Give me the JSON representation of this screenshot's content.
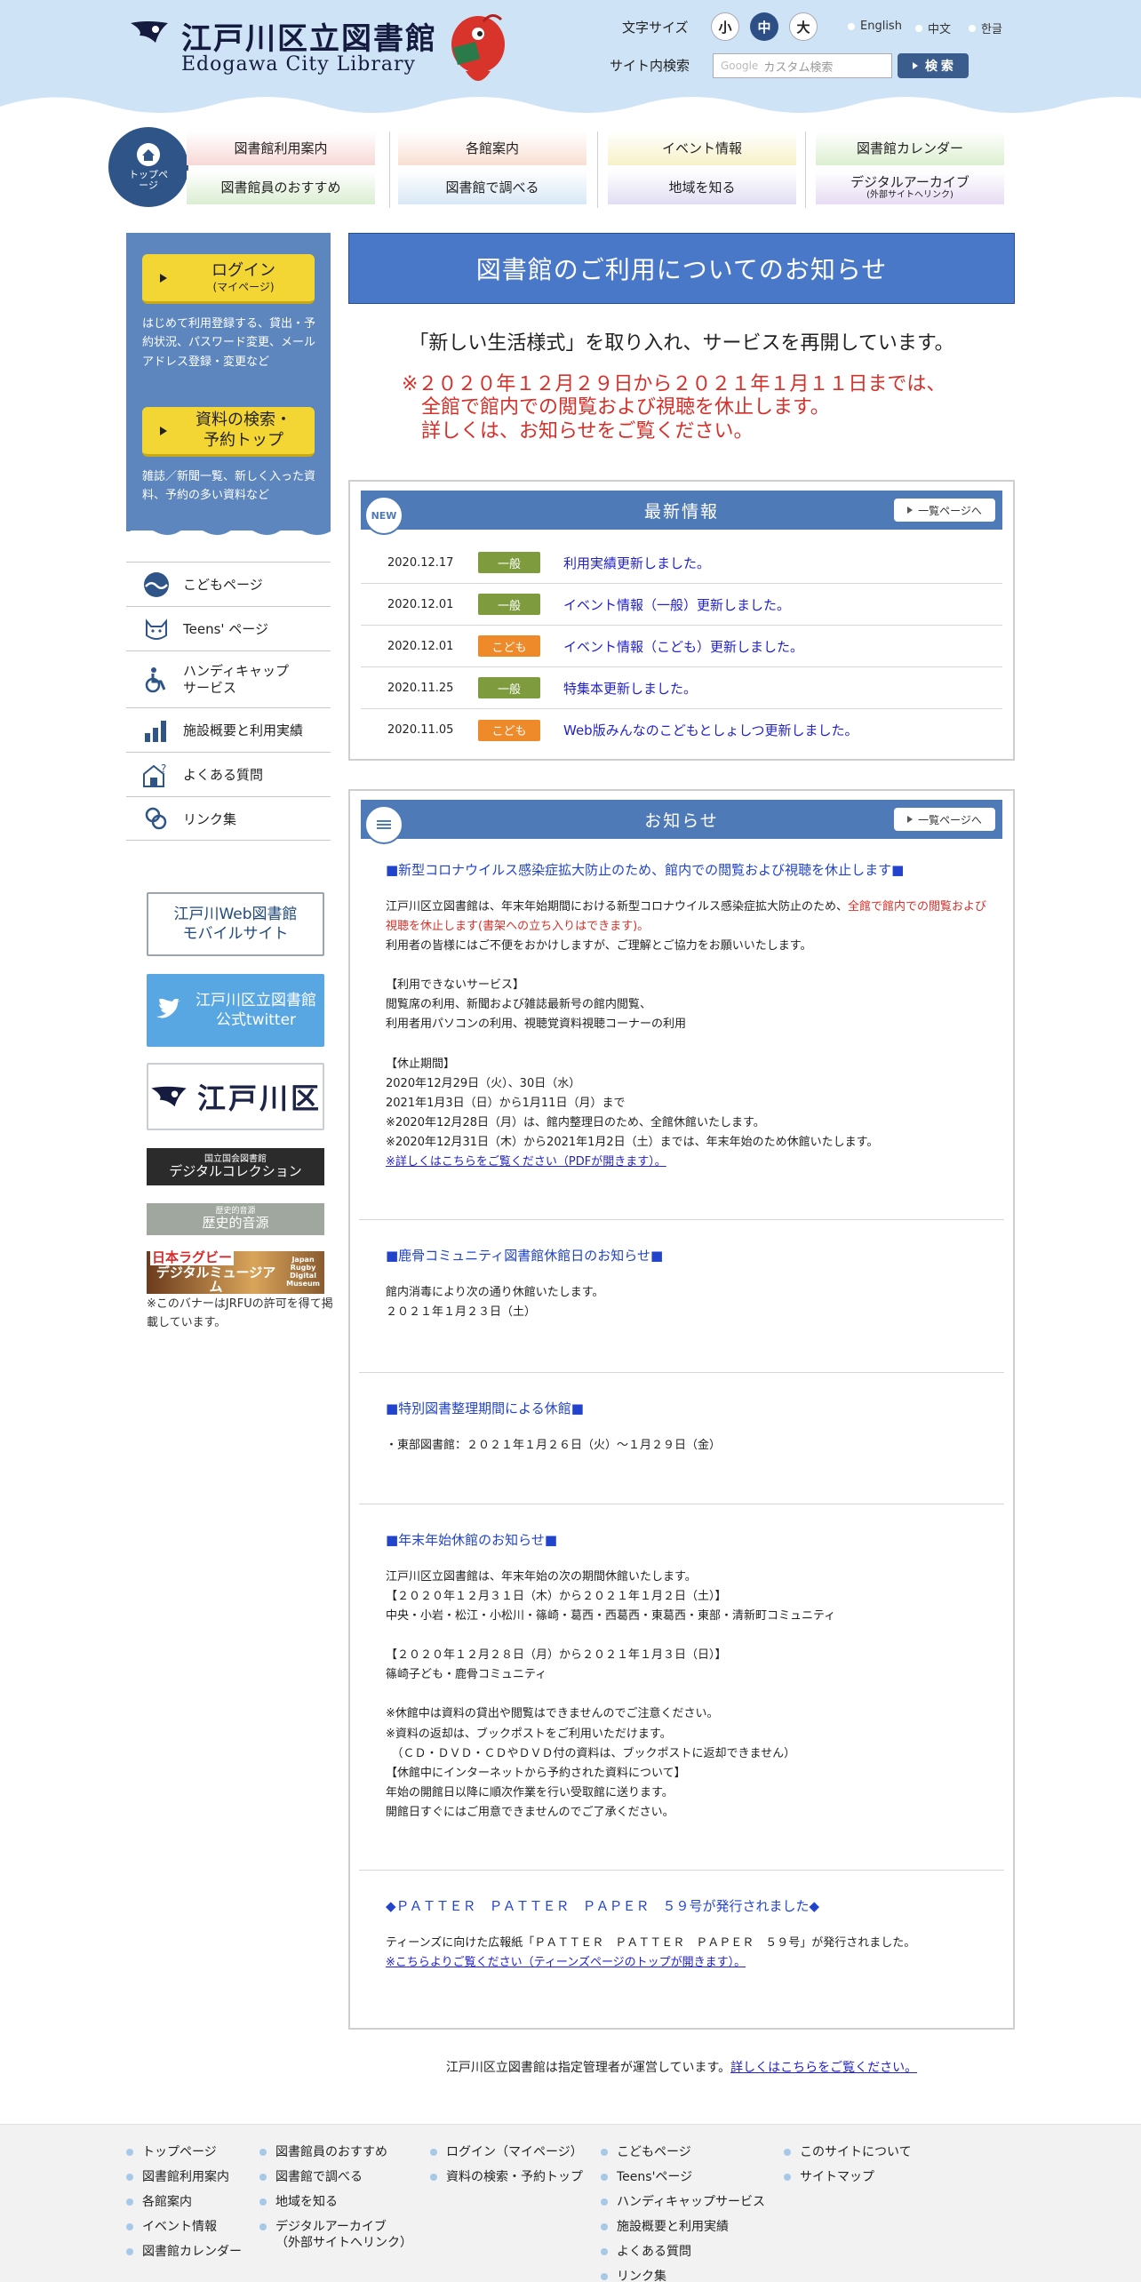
{
  "header": {
    "title": "江戸川区立図書館",
    "subtitle": "Edogawa City Library",
    "font_size_label": "文字サイズ",
    "font_sizes": [
      "小",
      "中",
      "大"
    ],
    "languages": [
      "English",
      "中文",
      "한글"
    ],
    "search_label": "サイト内検索",
    "search_placeholder": "カスタム検索",
    "search_google": "Google",
    "search_button": "検 索"
  },
  "nav": {
    "top_label": "トップページ",
    "items": [
      {
        "label": "図書館利用案内",
        "color": "#f7d9d6"
      },
      {
        "label": "各館案内",
        "color": "#f9dfd3"
      },
      {
        "label": "イベント情報",
        "color": "#f7f1c8"
      },
      {
        "label": "図書館カレンダー",
        "color": "#dcefd0"
      },
      {
        "label": "図書館員のおすすめ",
        "color": "#dbeed2"
      },
      {
        "label": "図書館で調べる",
        "color": "#d8e8f6"
      },
      {
        "label": "地域を知る",
        "color": "#e1def3"
      },
      {
        "label": "デジタルアーカイブ",
        "sub": "(外部サイトへリンク)",
        "color": "#e7dcf3"
      }
    ]
  },
  "sidebar": {
    "login_label": "ログイン",
    "login_sub": "(マイページ)",
    "login_desc": "はじめて利用登録する、貸出・予約状況、パスワード変更、メールアドレス登録・変更など",
    "search_label_1": "資料の検索・",
    "search_label_2": "予約トップ",
    "search_desc": "雑誌／新聞一覧、新しく入った資料、予約の多い資料など",
    "menu": [
      {
        "label": "こどもページ",
        "icon": "wave-icon"
      },
      {
        "label": "Teens' ページ",
        "icon": "cat-icon"
      },
      {
        "label": "ハンディキャップ",
        "label2": "サービス",
        "icon": "wheelchair-icon"
      },
      {
        "label": "施設概要と利用実績",
        "icon": "bar-chart-icon"
      },
      {
        "label": "よくある質問",
        "icon": "question-house-icon"
      },
      {
        "label": "リンク集",
        "icon": "link-icon"
      }
    ],
    "banners": {
      "web_1": "江戸川Web図書館",
      "web_2": "モバイルサイト",
      "tw_1": "江戸川区立図書館",
      "tw_2": "公式twitter",
      "edogawa": "江戸川区",
      "dc_small": "国立国会図書館",
      "dc": "デジタルコレクション",
      "hist_small": "歴史的音源",
      "hist": "歴史的音源",
      "rugby_1": "日本ラグビー",
      "rugby_2": "デジタルミュージアム",
      "rugby_en": "Japan Rugby Digital Museum"
    },
    "banner_note": "※このバナーはJRFUの許可を得て掲載しています。"
  },
  "notice": {
    "title": "図書館のご利用についてのお知らせ",
    "sub": "「新しい生活様式」を取り入れ、サービスを再開しています。",
    "red_1": "※２０２０年１２月２９日から２０２１年１月１１日までは、",
    "red_2": "全館で館内での閲覧および視聴を休止します。",
    "red_3": "詳しくは、お知らせをご覧ください。"
  },
  "latest": {
    "title": "最新情報",
    "badge": "NEW",
    "more": "一覧ページへ",
    "rows": [
      {
        "date": "2020.12.17",
        "tag": "一般",
        "tag_color": "#7e9c3d",
        "text": "利用実績更新しました。"
      },
      {
        "date": "2020.12.01",
        "tag": "一般",
        "tag_color": "#7e9c3d",
        "text": "イベント情報（一般）更新しました。"
      },
      {
        "date": "2020.12.01",
        "tag": "こども",
        "tag_color": "#ee8a2a",
        "text": "イベント情報（こども）更新しました。"
      },
      {
        "date": "2020.11.25",
        "tag": "一般",
        "tag_color": "#7e9c3d",
        "text": "特集本更新しました。"
      },
      {
        "date": "2020.11.05",
        "tag": "こども",
        "tag_color": "#ee8a2a",
        "text": "Web版みんなのこどもとしょしつ更新しました。"
      }
    ]
  },
  "oshirase": {
    "title": "お知らせ",
    "more": "一覧ページへ",
    "n1_title": "■新型コロナウイルス感染症拡大防止のため、館内での閲覧および視聴を休止します■",
    "n1_p1a": "江戸川区立図書館は、年末年始期間における新型コロナウイルス感染症拡大防止のため、",
    "n1_p1red": "全館で館内での閲覧および視聴を休止します(書架への立ち入りはできます)。",
    "n1_p2": "利用者の皆様にはご不便をおかけしますが、ご理解とご協力をお願いいたします。",
    "n1_h1": "【利用できないサービス】",
    "n1_s1": "閲覧席の利用、新聞および雑誌最新号の館内閲覧、",
    "n1_s2": "利用者用パソコンの利用、視聴覚資料視聴コーナーの利用",
    "n1_h2": "【休止期間】",
    "n1_d1": "2020年12月29日（火）、30日（水）",
    "n1_d2": "2021年1月3日（日）から1月11日（月）まで",
    "n1_d3": "※2020年12月28日（月）は、館内整理日のため、全館休館いたします。",
    "n1_d4": "※2020年12月31日（木）から2021年1月2日（土）までは、年末年始のため休館いたします。",
    "n1_link": "※詳しくはこちらをご覧ください（PDFが開きます）。",
    "n2_title": "■鹿骨コミュニティ図書館休館日のお知らせ■",
    "n2_p1": "館内消毒により次の通り休館いたします。",
    "n2_p2": "２０２１年１月２３日（土）",
    "n3_title": "■特別図書整理期間による休館■",
    "n3_p1": "・東部図書館：２０２１年１月２６日（火）〜１月２９日（金）",
    "n4_title": "■年末年始休館のお知らせ■",
    "n4_l1": "江戸川区立図書館は、年末年始の次の期間休館いたします。",
    "n4_l2": "【２０２０年１２月３１日（木）から２０２１年１月２日（土）】",
    "n4_l3": "中央・小岩・松江・小松川・篠崎・葛西・西葛西・東葛西・東部・清新町コミュニティ",
    "n4_l4": "【２０２０年１２月２８日（月）から２０２１年１月３日（日）】",
    "n4_l5": "篠崎子ども・鹿骨コミュニティ",
    "n4_l6": "※休館中は資料の貸出や閲覧はできませんのでご注意ください。",
    "n4_l7": "※資料の返却は、ブックポストをご利用いただけます。",
    "n4_l8": "　（ＣＤ・ＤＶＤ・ＣＤやＤＶＤ付の資料は、ブックポストに返却できません）",
    "n4_l9": "【休館中にインターネットから予約された資料について】",
    "n4_l10": "年始の開館日以降に順次作業を行い受取館に送ります。",
    "n4_l11": "開館日すぐにはご用意できませんのでご了承ください。",
    "n5_title": "◆ＰＡＴＴＥＲ　ＰＡＴＴＥＲ　ＰＡＰＥＲ　５９号が発行されました◆",
    "n5_p1": "ティーンズに向けた広報紙「ＰＡＴＴＥＲ　ＰＡＴＴＥＲ　ＰＡＰＥＲ　５９号」が発行されました。",
    "n5_link": "※こちらよりご覧ください（ティーンズページのトップが開きます）。"
  },
  "manager": {
    "text": "江戸川区立図書館は指定管理者が運営しています。",
    "link": "詳しくはこちらをご覧ください。"
  },
  "footer": {
    "col1": [
      "トップページ",
      "図書館利用案内",
      "各館案内",
      "イベント情報",
      "図書館カレンダー"
    ],
    "col2": [
      "図書館員のおすすめ",
      "図書館で調べる",
      "地域を知る",
      "デジタルアーカイブ"
    ],
    "col2_sub": "（外部サイトへリンク）",
    "col3": [
      "ログイン（マイページ）",
      "資料の検索・予約トップ"
    ],
    "col4": [
      "こどもページ",
      "Teens'ページ",
      "ハンディキャップサービス",
      "施設概要と利用実績",
      "よくある質問",
      "リンク集"
    ],
    "col5": [
      "このサイトについて",
      "サイトマップ"
    ]
  }
}
